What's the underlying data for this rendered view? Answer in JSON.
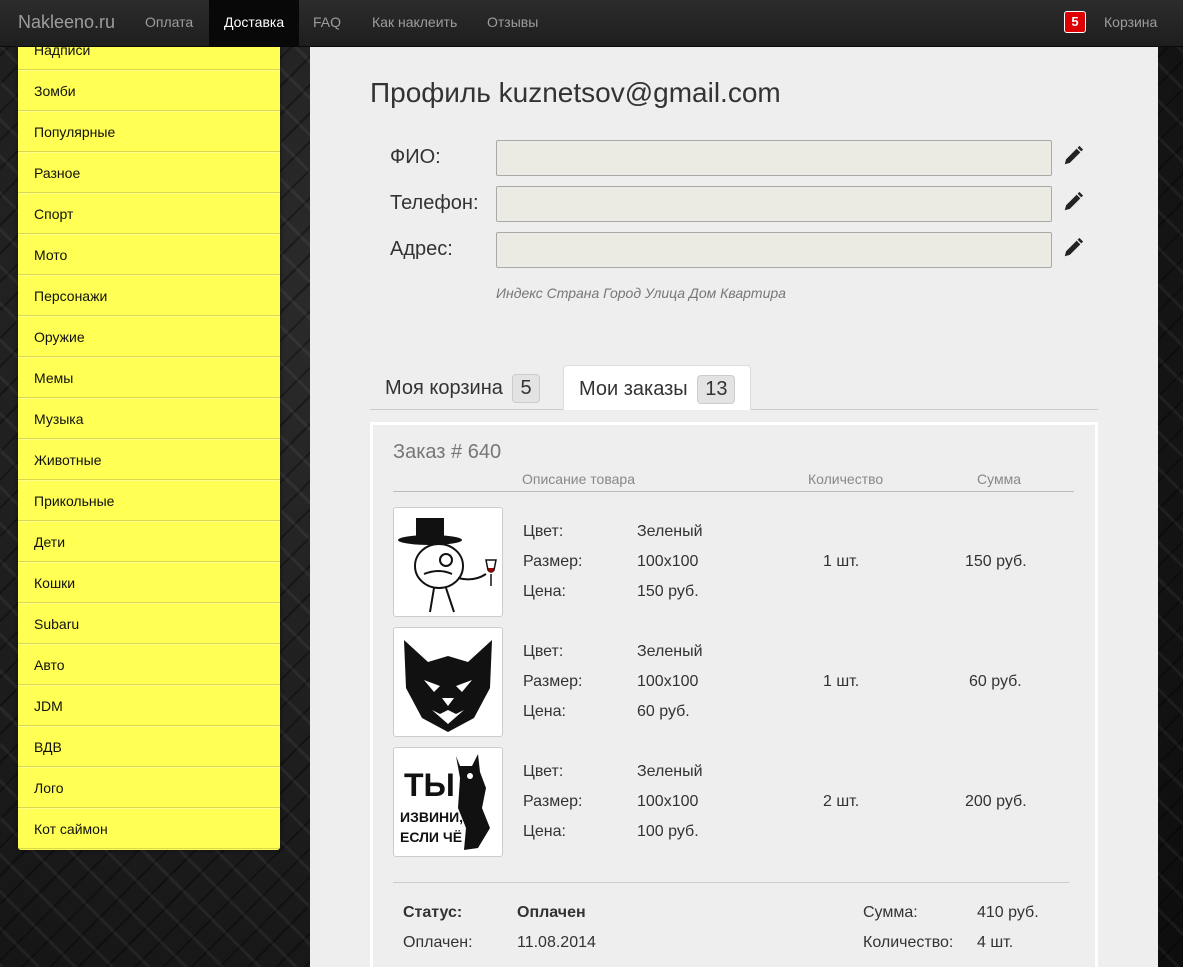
{
  "nav": {
    "brand": "Nakleeno.ru",
    "items": [
      "Оплата",
      "Доставка",
      "FAQ",
      "Как наклеить",
      "Отзывы"
    ],
    "active_index": 1,
    "cart_count": "5",
    "cart_label": "Корзина"
  },
  "sidebar": {
    "items": [
      "Надписи",
      "Зомби",
      "Популярные",
      "Разное",
      "Спорт",
      "Мото",
      "Персонажи",
      "Оружие",
      "Мемы",
      "Музыка",
      "Животные",
      "Прикольные",
      "Дети",
      "Кошки",
      "Subaru",
      "Авто",
      "JDM",
      "ВДВ",
      "Лого",
      "Кот саймон"
    ]
  },
  "profile": {
    "title": "Профиль kuznetsov@gmail.com",
    "fields": [
      {
        "label": "ФИО:",
        "value": ""
      },
      {
        "label": "Телефон:",
        "value": ""
      },
      {
        "label": "Адрес:",
        "value": ""
      }
    ],
    "address_hint": "Индекс Страна Город Улица Дом Квартира"
  },
  "tabs": [
    {
      "label": "Моя корзина",
      "count": "5",
      "active": false
    },
    {
      "label": "Мои заказы",
      "count": "13",
      "active": true
    }
  ],
  "order": {
    "title": "Заказ # 640",
    "columns": {
      "desc": "Описание товара",
      "qty": "Количество",
      "sum": "Сумма"
    },
    "attr_labels": {
      "color": "Цвет:",
      "size": "Размер:",
      "price": "Цена:"
    },
    "items": [
      {
        "image": "gentleman-meme-sticker",
        "color": "Зеленый",
        "size": "100x100",
        "price": "150 руб.",
        "qty": "1 шт.",
        "sum": "150 руб."
      },
      {
        "image": "wolf-head-sticker",
        "color": "Зеленый",
        "size": "100x100",
        "price": "60 руб.",
        "qty": "1 шт.",
        "sum": "60 руб."
      },
      {
        "image": "wolf-text-sticker",
        "color": "Зеленый",
        "size": "100x100",
        "price": "100 руб.",
        "qty": "2 шт.",
        "sum": "200 руб."
      }
    ],
    "sticker3_text": {
      "line1": "ТЫ",
      "line2": "ИЗВИНИ,",
      "line3": "ЕСЛИ ЧЁ"
    },
    "status_label": "Статус:",
    "status_value": "Оплачен",
    "paid_label": "Оплачен:",
    "paid_value": "11.08.2014",
    "sum_label": "Сумма:",
    "sum_value": "410 руб.",
    "qty_label": "Количество:",
    "qty_value": "4 шт."
  }
}
